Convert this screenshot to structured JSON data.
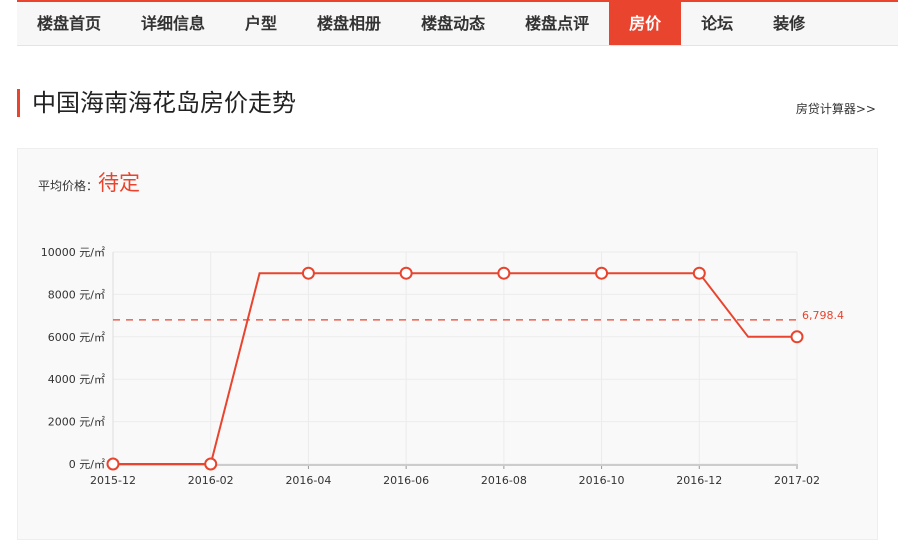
{
  "nav": {
    "items": [
      "楼盘首页",
      "详细信息",
      "户型",
      "楼盘相册",
      "楼盘动态",
      "楼盘点评",
      "房价",
      "论坛",
      "装修"
    ],
    "active_index": 6
  },
  "page_title": "中国海南海花岛房价走势",
  "calculator_link": "房贷计算器>>",
  "avg_price": {
    "label": "平均价格：",
    "value": "待定"
  },
  "colors": {
    "accent": "#e8442e"
  },
  "chart_data": {
    "type": "line",
    "x": [
      "2015-12",
      "2016-01",
      "2016-02",
      "2016-03",
      "2016-04",
      "2016-05",
      "2016-06",
      "2016-07",
      "2016-08",
      "2016-09",
      "2016-10",
      "2016-11",
      "2016-12",
      "2017-01",
      "2017-02"
    ],
    "values": [
      0,
      0,
      0,
      9000,
      9000,
      9000,
      9000,
      9000,
      9000,
      9000,
      9000,
      9000,
      9000,
      6000,
      6000
    ],
    "xticks": [
      "2015-12",
      "2016-02",
      "2016-04",
      "2016-06",
      "2016-08",
      "2016-10",
      "2016-12",
      "2017-02"
    ],
    "yticks": [
      "0 元/㎡",
      "2000 元/㎡",
      "4000 元/㎡",
      "6000 元/㎡",
      "8000 元/㎡",
      "10000 元/㎡"
    ],
    "ylim": [
      0,
      10000
    ],
    "average_line": {
      "value": 6798.4,
      "label": "6,798.4"
    },
    "grid": true
  }
}
